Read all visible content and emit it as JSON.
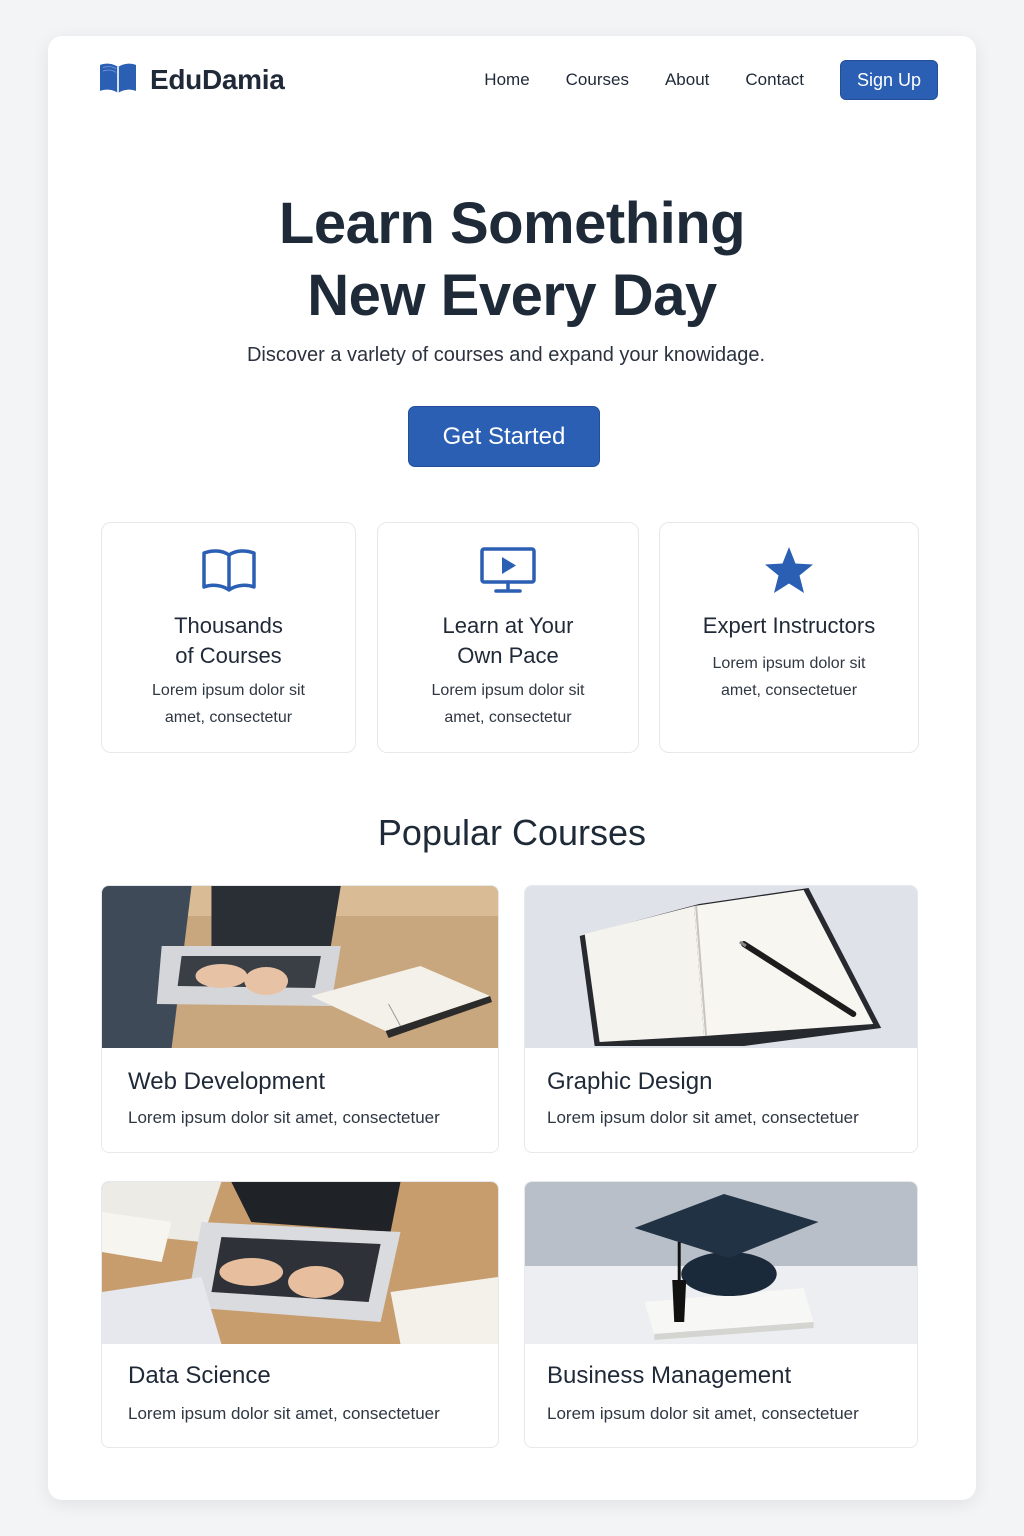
{
  "brand": {
    "name": "EduDamia",
    "logo_icon": "open-book-icon"
  },
  "nav": {
    "links": [
      "Home",
      "Courses",
      "About",
      "Contact"
    ],
    "signup_label": "Sign Up"
  },
  "hero": {
    "title_line1": "Learn Something",
    "title_line2": "New Every Day",
    "subtitle": "Discover a varlety of courses and expand your knowidage.",
    "cta_label": "Get Started"
  },
  "features": [
    {
      "icon": "open-book-icon",
      "title_line1": "Thousands",
      "title_line2": "of Courses",
      "text_line1": "Lorem ipsum dolor sit",
      "text_line2": "amet, consectetur"
    },
    {
      "icon": "monitor-play-icon",
      "title_line1": "Learn at Your",
      "title_line2": "Own Pace",
      "text_line1": "Lorem ipsum dolor sit",
      "text_line2": "amet, consectetur"
    },
    {
      "icon": "star-icon",
      "title_line1": "Expert Instructors",
      "text_line1": "Lorem ipsum dolor sit",
      "text_line2": "amet, consectetuer"
    }
  ],
  "popular": {
    "title": "Popular Courses",
    "courses": [
      {
        "title": "Web Development",
        "desc": "Lorem ipsum dolor sit amet, consectetuer",
        "image": "laptop-typing-photo"
      },
      {
        "title": "Graphic Design",
        "desc": "Lorem ipsum dolor sit amet, consectetuer",
        "image": "notebook-pen-photo"
      },
      {
        "title": "Data Science",
        "desc": "Lorem ipsum dolor sit amet, consectetuer",
        "image": "laptop-book-photo"
      },
      {
        "title": "Business Management",
        "desc": "Lorem ipsum dolor sit amet, consectetuer",
        "image": "graduation-cap-photo"
      }
    ]
  },
  "colors": {
    "accent": "#2b5fb4",
    "text": "#1f2937",
    "background": "#f3f4f6"
  }
}
